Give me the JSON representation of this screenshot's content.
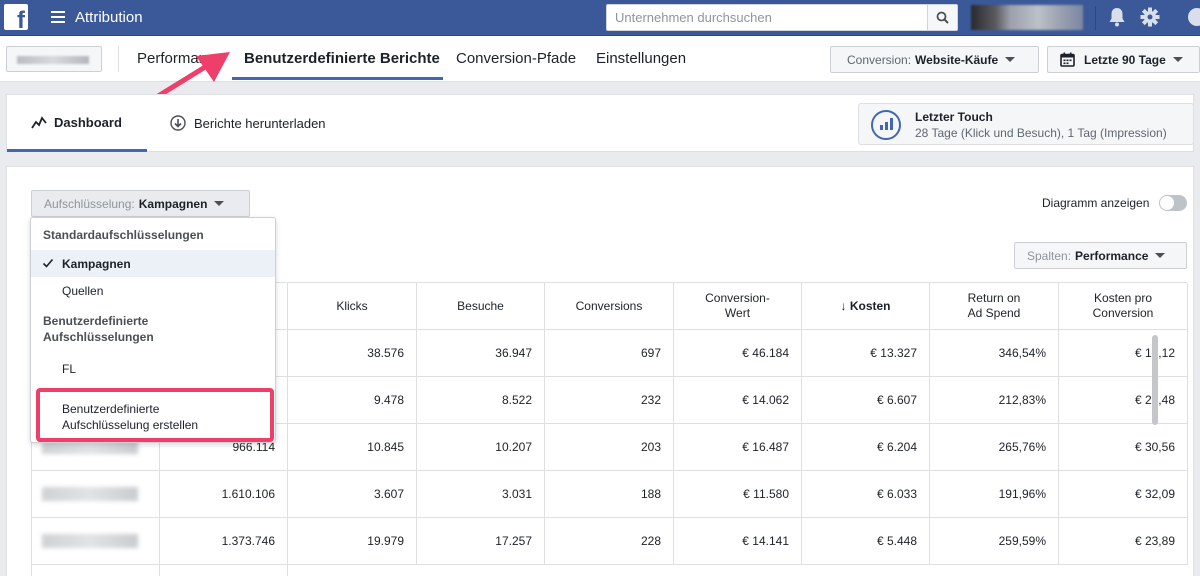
{
  "topbar": {
    "app_title": "Attribution",
    "search_placeholder": "Unternehmen durchsuchen",
    "icons": [
      "facebook-logo-icon",
      "hamburger-icon",
      "search-icon",
      "bell-icon",
      "gear-icon",
      "more-icon"
    ]
  },
  "nav": {
    "tabs": [
      {
        "label": "Performance",
        "active": false
      },
      {
        "label": "Benutzerdefinierte Berichte",
        "active": true
      },
      {
        "label": "Conversion-Pfade",
        "active": false
      },
      {
        "label": "Einstellungen",
        "active": false
      }
    ],
    "conversion_label": "Conversion:",
    "conversion_value": "Website-Käufe",
    "date_range": "Letzte 90 Tage"
  },
  "subnav": {
    "dashboard_label": "Dashboard",
    "download_label": "Berichte herunterladen",
    "attribution_title": "Letzter Touch",
    "attribution_sub": "28 Tage (Klick und Besuch), 1 Tag (Impression)"
  },
  "controls": {
    "breakdown_label": "Aufschlüsselung:",
    "breakdown_value": "Kampagnen",
    "chart_toggle_label": "Diagramm anzeigen",
    "chart_toggle_on": false,
    "columns_label": "Spalten:",
    "columns_value": "Performance"
  },
  "dropdown": {
    "standard_heading": "Standardaufschlüsselungen",
    "standard_items": [
      {
        "label": "Kampagnen",
        "selected": true
      },
      {
        "label": "Quellen",
        "selected": false
      }
    ],
    "custom_heading_line1": "Benutzerdefinierte",
    "custom_heading_line2": "Aufschlüsselungen",
    "custom_items": [
      {
        "label": "FL",
        "selected": false
      }
    ],
    "create_line1": "Benutzerdefinierte",
    "create_line2": "Aufschlüsselung erstellen"
  },
  "table": {
    "headers": [
      {
        "line1": "Klicks",
        "line2": ""
      },
      {
        "line1": "Besuche",
        "line2": ""
      },
      {
        "line1": "Conversions",
        "line2": ""
      },
      {
        "line1": "Conversion-",
        "line2": "Wert"
      },
      {
        "line1": "↓ Kosten",
        "line2": ""
      },
      {
        "line1": "Return on",
        "line2": "Ad Spend"
      },
      {
        "line1": "Kosten pro",
        "line2": "Conversion"
      }
    ],
    "rows": [
      {
        "impressions": "",
        "klicks": "38.576",
        "besuche": "36.947",
        "conversions": "697",
        "wert": "€ 46.184",
        "kosten": "€ 13.327",
        "roas": "346,54%",
        "cpc": "€ 19,12"
      },
      {
        "impressions": "",
        "klicks": "9.478",
        "besuche": "8.522",
        "conversions": "232",
        "wert": "€ 14.062",
        "kosten": "€ 6.607",
        "roas": "212,83%",
        "cpc": "€ 28,48"
      },
      {
        "impressions": "966.114",
        "klicks": "10.845",
        "besuche": "10.207",
        "conversions": "203",
        "wert": "€ 16.487",
        "kosten": "€ 6.204",
        "roas": "265,76%",
        "cpc": "€ 30,56"
      },
      {
        "impressions": "1.610.106",
        "klicks": "3.607",
        "besuche": "3.031",
        "conversions": "188",
        "wert": "€ 11.580",
        "kosten": "€ 6.033",
        "roas": "191,96%",
        "cpc": "€ 32,09"
      },
      {
        "impressions": "1.373.746",
        "klicks": "19.979",
        "besuche": "17.257",
        "conversions": "228",
        "wert": "€ 14.141",
        "kosten": "€ 5.448",
        "roas": "259,59%",
        "cpc": "€ 23,89"
      }
    ]
  },
  "colors": {
    "topbar": "#3b5998",
    "accent": "#4267b2",
    "highlight": "#ee3f6b"
  }
}
